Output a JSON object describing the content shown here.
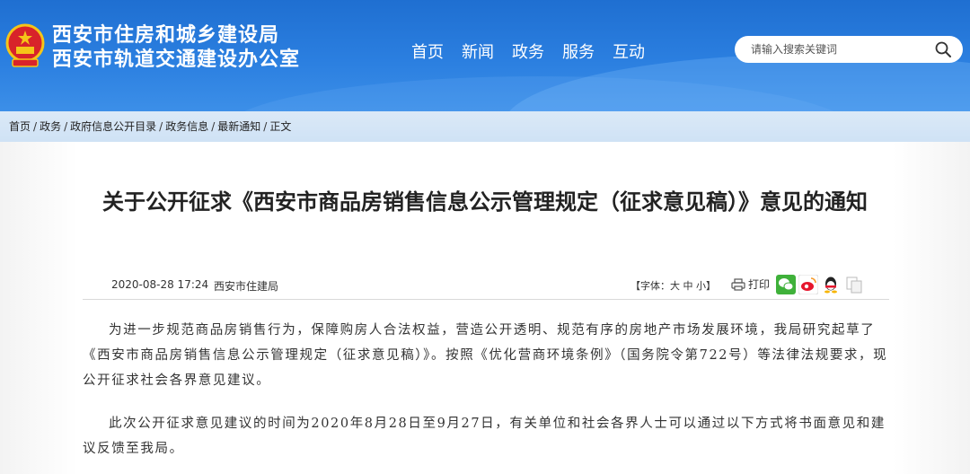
{
  "header": {
    "title_line1": "西安市住房和城乡建设局",
    "title_line2": "西安市轨道交通建设办公室",
    "nav": [
      "首页",
      "新闻",
      "政务",
      "服务",
      "互动"
    ],
    "search_placeholder": "请输入搜索关键词",
    "brand_color": "#2b7fe0"
  },
  "breadcrumb": {
    "items": [
      "首页",
      "政务",
      "政府信息公开目录",
      "政务信息",
      "最新通知",
      "正文"
    ],
    "separator": "/"
  },
  "article": {
    "title": "关于公开征求《西安市商品房销售信息公示管理规定（征求意见稿）》意见的通知",
    "date": "2020-08-28 17:24",
    "source": "西安市住建局",
    "font_size_label": "【字体：",
    "font_size_options": [
      "大",
      "中",
      "小"
    ],
    "font_size_close": "】",
    "print_label": "打印",
    "share_icons": [
      "wechat-icon",
      "weibo-icon",
      "qq-icon",
      "copy-icon"
    ],
    "paragraphs": [
      "为进一步规范商品房销售行为，保障购房人合法权益，营造公开透明、规范有序的房地产市场发展环境，我局研究起草了《西安市商品房销售信息公示管理规定（征求意见稿）》。按照《优化营商环境条例》（国务院令第722号）等法律法规要求，现公开征求社会各界意见建议。",
      "此次公开征求意见建议的时间为2020年8月28日至9月27日，有关单位和社会各界人士可以通过以下方式将书面意见和建议反馈至我局。"
    ]
  }
}
